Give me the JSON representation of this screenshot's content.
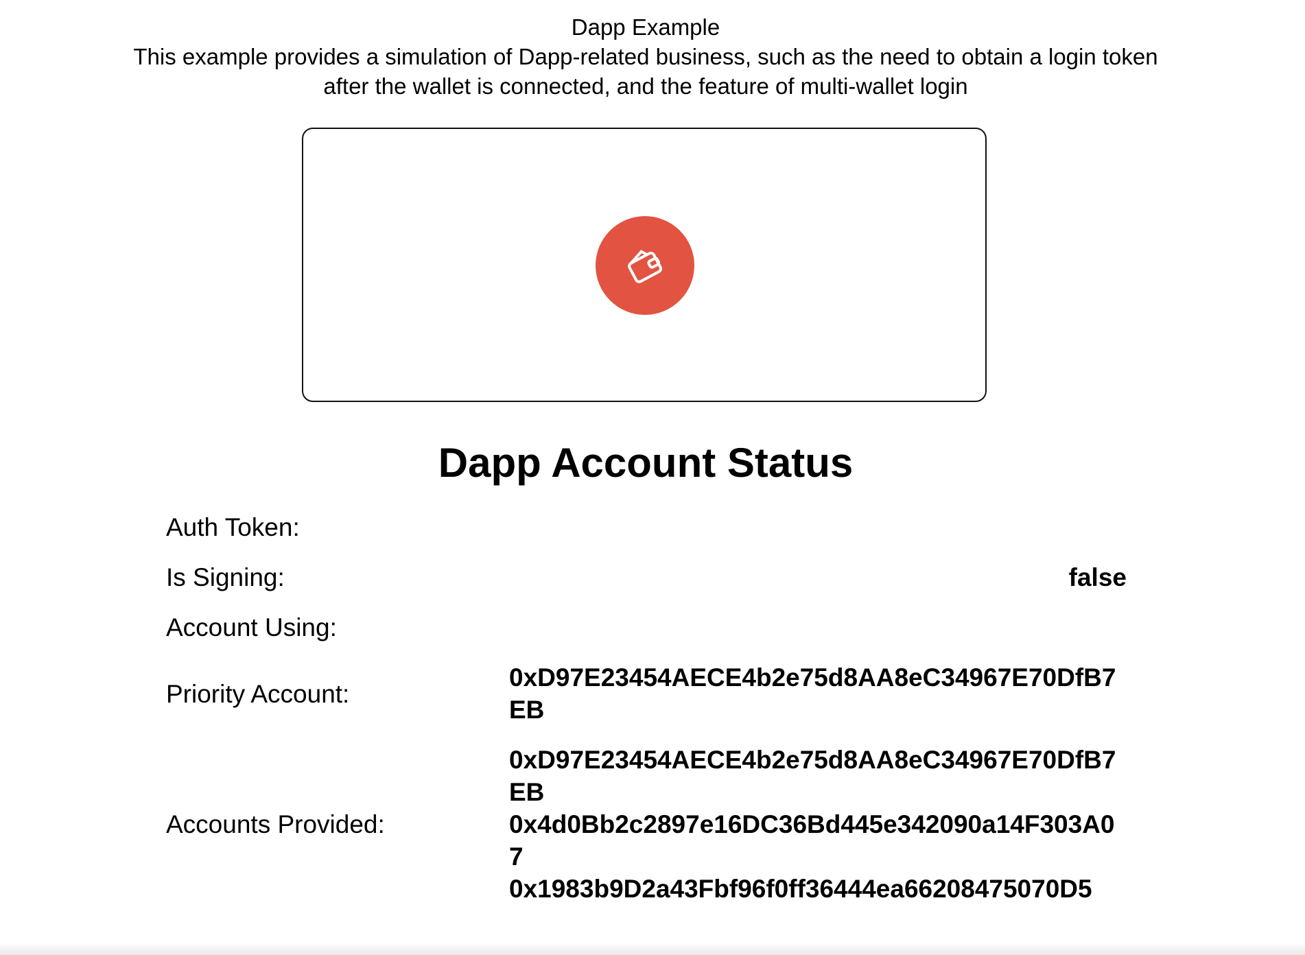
{
  "header": {
    "title": "Dapp Example",
    "description": "This example provides a simulation of Dapp-related business, such as the need to obtain a login token after the wallet is connected, and the feature of multi-wallet login"
  },
  "wallet_button": {
    "icon": "wallet-icon",
    "color": "#e35341"
  },
  "status": {
    "title": "Dapp Account Status",
    "auth_token_label": "Auth Token:",
    "auth_token_value": "",
    "is_signing_label": "Is Signing:",
    "is_signing_value": "false",
    "account_using_label": "Account Using:",
    "account_using_value": "",
    "priority_account_label": "Priority Account:",
    "priority_account_value": "0xD97E23454AECE4b2e75d8AA8eC34967E70DfB7EB",
    "accounts_provided_label": "Accounts Provided:",
    "accounts_provided": [
      "0xD97E23454AECE4b2e75d8AA8eC34967E70DfB7EB",
      "0x4d0Bb2c2897e16DC36Bd445e342090a14F303A07",
      "0x1983b9D2a43Fbf96f0ff36444ea66208475070D5"
    ]
  }
}
